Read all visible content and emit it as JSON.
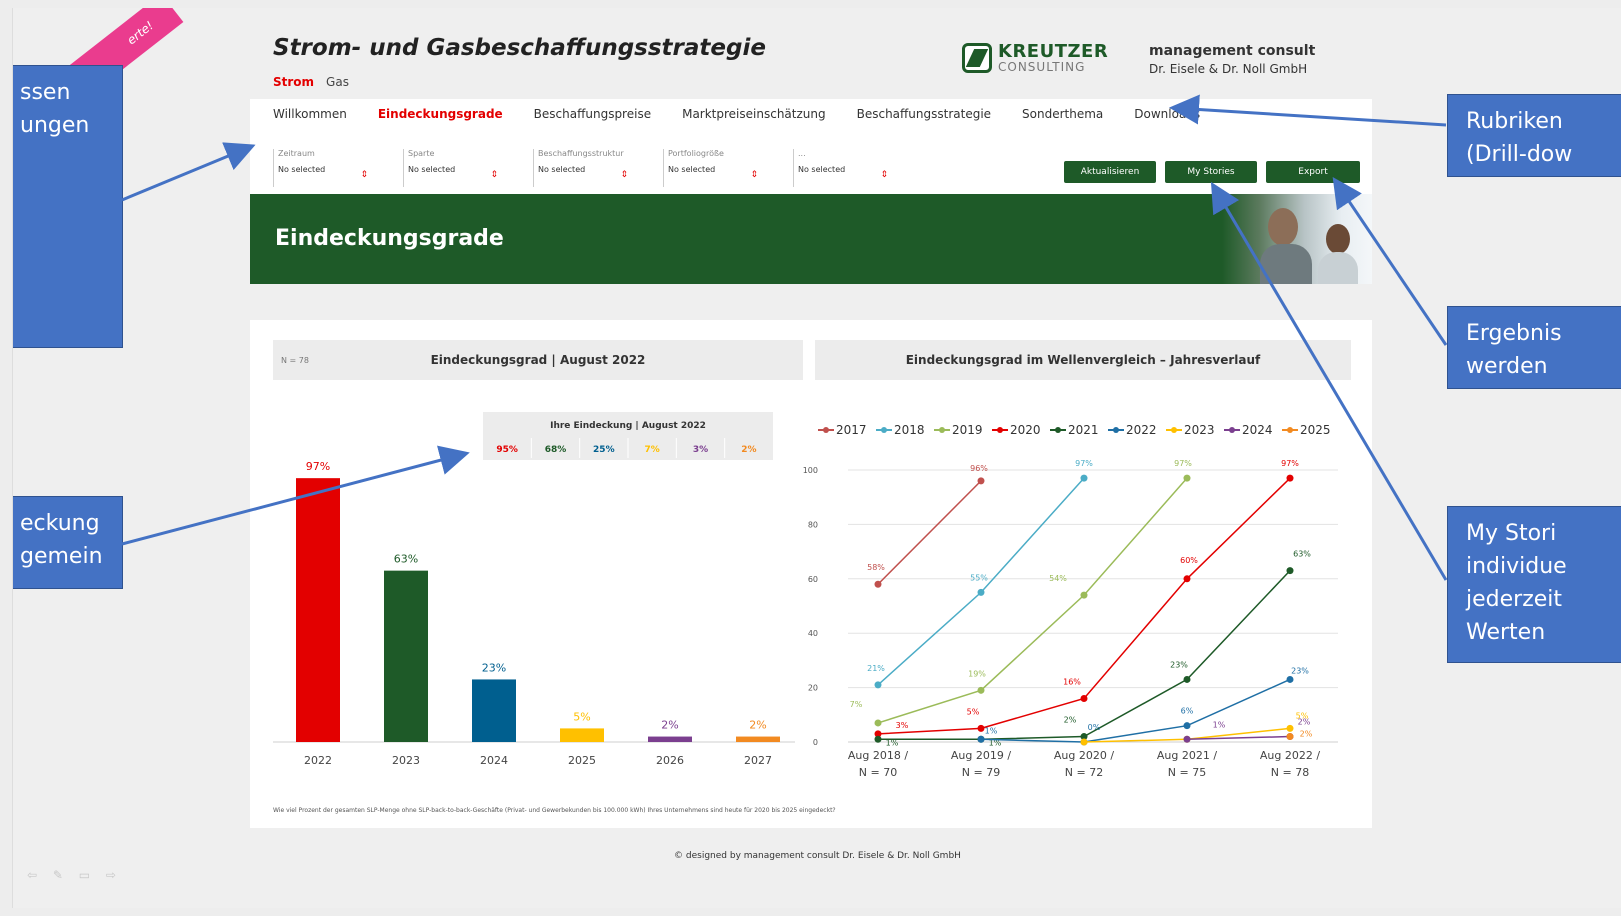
{
  "ribbon": {
    "text": "erte!"
  },
  "callouts": {
    "left_top": "ssen\nungen",
    "left_bottom": "eckung\ngemein",
    "right_1": "Rubriken\n(Drill-dow",
    "right_2": "Ergebnis\nwerden",
    "right_3": "My Stori\nindividue\njederzeit\nWerten"
  },
  "app": {
    "title": "Strom- und Gasbeschaffungsstrategie",
    "energy_tabs": [
      "Strom",
      "Gas"
    ]
  },
  "logo": {
    "line1": "KREUTZER",
    "line2": "CONSULTING"
  },
  "company": {
    "line1": "management consult",
    "line2": "Dr. Eisele & Dr. Noll GmbH"
  },
  "nav": {
    "items": [
      "Willkommen",
      "Eindeckungsgrade",
      "Beschaffungspreise",
      "Marktpreiseinschätzung",
      "Beschaffungsstrategie",
      "Sonderthema",
      "Downloads"
    ],
    "active_index": 1
  },
  "filters": [
    {
      "label": "Zeitraum",
      "value": "No selected"
    },
    {
      "label": "Sparte",
      "value": "No selected"
    },
    {
      "label": "Beschaffungsstruktur",
      "value": "No selected"
    },
    {
      "label": "Portfoliogröße",
      "value": "No selected"
    },
    {
      "label": "...",
      "value": "No selected"
    }
  ],
  "buttons": {
    "refresh": "Aktualisieren",
    "stories": "My Stories",
    "export": "Export"
  },
  "banner": {
    "title": "Eindeckungsgrade"
  },
  "left_panel": {
    "n_label": "N = 78",
    "title": "Eindeckungsgrad | August 2022"
  },
  "right_panel": {
    "title": "Eindeckungsgrad im Wellenvergleich – Jahresverlauf"
  },
  "footnote": "Wie viel Prozent der gesamten SLP-Menge ohne SLP-back-to-back-Geschäfte (Privat- und Gewerbekunden bis 100.000 kWh) Ihres Unternehmens sind heute für 2020 bis 2025 eingedeckt?",
  "copyright": "© designed by management consult Dr. Eisele & Dr. Noll GmbH",
  "colors": {
    "green": "#1e5a28",
    "red": "#e30000",
    "callout": "#4472c4"
  },
  "chart_data": [
    {
      "type": "bar",
      "title": "Eindeckungsgrad | August 2022",
      "categories": [
        "2022",
        "2023",
        "2024",
        "2025",
        "2026",
        "2027"
      ],
      "values": [
        97,
        63,
        23,
        5,
        2,
        2
      ],
      "labels": [
        "97%",
        "63%",
        "23%",
        "5%",
        "2%",
        "2%"
      ],
      "colors": [
        "#e30000",
        "#1e5a28",
        "#005f8f",
        "#ffc000",
        "#7b3f8f",
        "#f28a21"
      ],
      "ylim": [
        0,
        100
      ],
      "inset_table": {
        "title": "Ihre Eindeckung | August 2022",
        "values": [
          "95%",
          "68%",
          "25%",
          "7%",
          "3%",
          "2%"
        ],
        "colors": [
          "#e30000",
          "#1e5a28",
          "#005f8f",
          "#ffc000",
          "#7b3f8f",
          "#f28a21"
        ]
      }
    },
    {
      "type": "line",
      "title": "Eindeckungsgrad im Wellenvergleich – Jahresverlauf",
      "x": [
        "Aug 2018 / N = 70",
        "Aug 2019 / N = 79",
        "Aug 2020 / N = 72",
        "Aug 2021 / N = 75",
        "Aug 2022 / N = 78"
      ],
      "x_top": [
        "Aug 2018 /",
        "Aug 2019 /",
        "Aug 2020 /",
        "Aug 2021 /",
        "Aug 2022 /"
      ],
      "x_bottom": [
        "N = 70",
        "N = 79",
        "N = 72",
        "N = 75",
        "N = 78"
      ],
      "ylim": [
        0,
        100
      ],
      "yticks": [
        "0",
        "20",
        "40",
        "60",
        "80",
        "100"
      ],
      "legend_position": "top",
      "series": [
        {
          "name": "2017",
          "color": "#c0504d",
          "values": [
            58,
            96,
            null,
            null,
            null
          ],
          "labels": [
            "58%",
            "96%",
            null,
            null,
            null
          ]
        },
        {
          "name": "2018",
          "color": "#4bacc6",
          "values": [
            21,
            55,
            97,
            null,
            null
          ],
          "labels": [
            "21%",
            "55%",
            "97%",
            null,
            null
          ]
        },
        {
          "name": "2019",
          "color": "#9bbb59",
          "values": [
            7,
            19,
            54,
            97,
            null
          ],
          "labels": [
            "7%",
            "19%",
            "54%",
            "97%",
            null
          ]
        },
        {
          "name": "2020",
          "color": "#e30000",
          "values": [
            3,
            5,
            16,
            60,
            97
          ],
          "labels": [
            "3%",
            "5%",
            "16%",
            "60%",
            "97%"
          ]
        },
        {
          "name": "2021",
          "color": "#1e5a28",
          "values": [
            1,
            1,
            2,
            23,
            63
          ],
          "labels": [
            "1%",
            "1%",
            "2%",
            "23%",
            "63%"
          ]
        },
        {
          "name": "2022",
          "color": "#1f6fa5",
          "values": [
            null,
            1,
            0,
            6,
            23
          ],
          "labels": [
            null,
            "1%",
            "0%",
            "6%",
            "23%"
          ]
        },
        {
          "name": "2023",
          "color": "#ffc000",
          "values": [
            null,
            null,
            0,
            1,
            5
          ],
          "labels": [
            null,
            null,
            null,
            null,
            "5%"
          ]
        },
        {
          "name": "2024",
          "color": "#7b3f8f",
          "values": [
            null,
            null,
            null,
            1,
            2
          ],
          "labels": [
            null,
            null,
            null,
            "1%",
            "2%"
          ]
        },
        {
          "name": "2025",
          "color": "#f28a21",
          "values": [
            null,
            null,
            null,
            null,
            2
          ],
          "labels": [
            null,
            null,
            null,
            null,
            "2%"
          ]
        }
      ]
    }
  ]
}
